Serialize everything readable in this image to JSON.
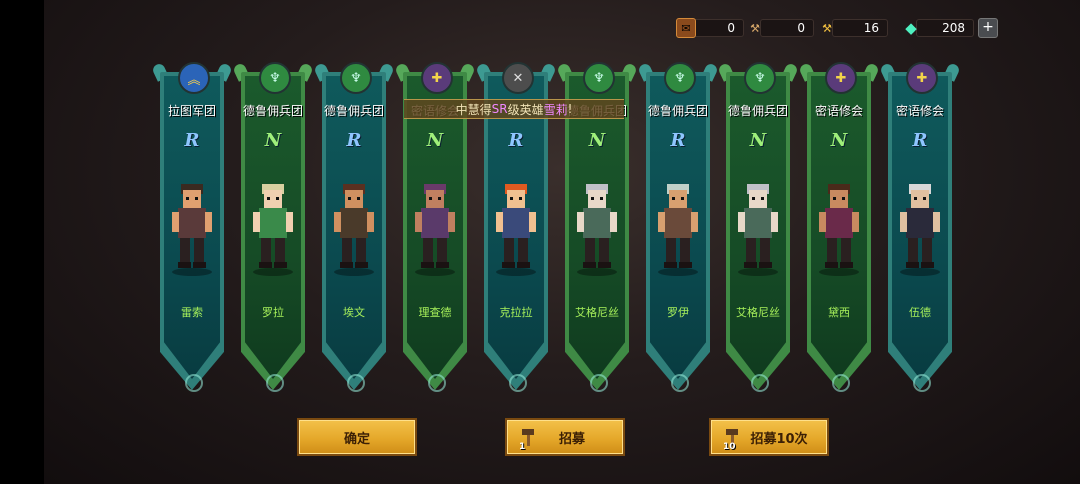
{
  "resources": [
    {
      "icon": "scroll-icon",
      "value": "0"
    },
    {
      "icon": "hammer-icon",
      "value": "0"
    },
    {
      "icon": "golden-hammer-icon",
      "value": "16"
    },
    {
      "icon": "gem-icon",
      "value": "208"
    }
  ],
  "add_label": "+",
  "notice": {
    "prefix": "中慧得",
    "grade": "SR",
    "middle": "级英雄",
    "hero": "雪莉",
    "suffix": "!"
  },
  "cards": [
    {
      "faction": "拉图军团",
      "grade": "R",
      "name": "雷索",
      "theme": "teal",
      "emblem": "rank-chevron-icon"
    },
    {
      "faction": "德鲁佣兵团",
      "grade": "N",
      "name": "罗拉",
      "theme": "green",
      "emblem": "dragon-crest-icon"
    },
    {
      "faction": "德鲁佣兵团",
      "grade": "R",
      "name": "埃文",
      "theme": "teal",
      "emblem": "dragon-crest-icon"
    },
    {
      "faction": "密语修会",
      "grade": "N",
      "name": "理查德",
      "theme": "green",
      "emblem": "holy-cross-icon"
    },
    {
      "faction": "",
      "grade": "R",
      "name": "克拉拉",
      "theme": "teal",
      "emblem": "crossed-swords-icon"
    },
    {
      "faction": "德鲁佣兵团",
      "grade": "N",
      "name": "艾格尼丝",
      "theme": "green",
      "emblem": "dragon-crest-icon"
    },
    {
      "faction": "德鲁佣兵团",
      "grade": "R",
      "name": "罗伊",
      "theme": "teal",
      "emblem": "dragon-crest-icon"
    },
    {
      "faction": "德鲁佣兵团",
      "grade": "N",
      "name": "艾格尼丝",
      "theme": "green",
      "emblem": "dragon-crest-icon"
    },
    {
      "faction": "密语修会",
      "grade": "N",
      "name": "黛西",
      "theme": "green",
      "emblem": "holy-cross-icon"
    },
    {
      "faction": "密语修会",
      "grade": "R",
      "name": "伍德",
      "theme": "teal",
      "emblem": "holy-cross-icon"
    }
  ],
  "buttons": {
    "confirm": "确定",
    "recruit_one": "招募",
    "recruit_one_count": "1",
    "recruit_ten": "招募10次",
    "recruit_ten_count": "10"
  },
  "colors": {
    "accent": "#e5a82a",
    "teal_card": "#0f5a5c",
    "green_card": "#1b5a2c",
    "hero_name": "#a7f05a"
  }
}
